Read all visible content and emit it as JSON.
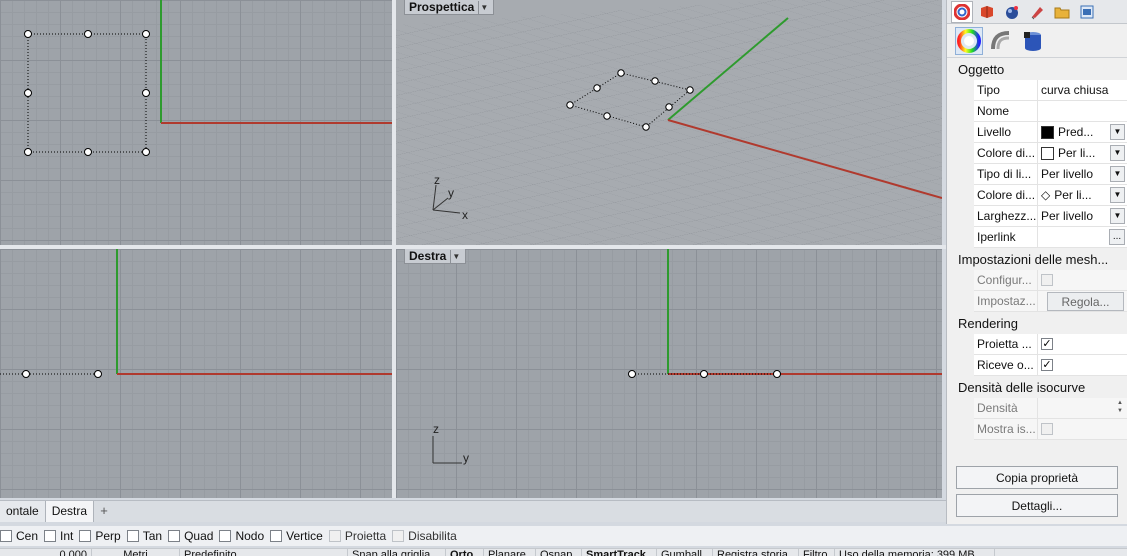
{
  "viewports": {
    "top": {
      "label": ""
    },
    "perspective": {
      "label": "Prospettica"
    },
    "front": {
      "label": ""
    },
    "right": {
      "label": "Destra"
    }
  },
  "axis_labels": {
    "x": "x",
    "y": "y",
    "z": "z"
  },
  "viewport_tabs": [
    {
      "label": "ontale",
      "active": false
    },
    {
      "label": "Destra",
      "active": true
    }
  ],
  "add_tab": "+",
  "osnaps": [
    {
      "label": "Cen",
      "checked": false,
      "enabled": true
    },
    {
      "label": "Int",
      "checked": false,
      "enabled": true
    },
    {
      "label": "Perp",
      "checked": false,
      "enabled": true
    },
    {
      "label": "Tan",
      "checked": false,
      "enabled": true
    },
    {
      "label": "Quad",
      "checked": false,
      "enabled": true
    },
    {
      "label": "Nodo",
      "checked": false,
      "enabled": true
    },
    {
      "label": "Vertice",
      "checked": false,
      "enabled": true
    },
    {
      "label": "Proietta",
      "checked": false,
      "enabled": false
    },
    {
      "label": "Disabilita",
      "checked": false,
      "enabled": false
    }
  ],
  "status": [
    "0.000",
    "Metri",
    "Predefinito",
    "Snap alla griglia",
    "Orto",
    "Planare",
    "Osnap",
    "SmartTrack",
    "Gumball",
    "Registra storia",
    "Filtro",
    "Uso della memoria: 399 MB"
  ],
  "panel": {
    "section_object": "Oggetto",
    "rows": {
      "tipo": {
        "label": "Tipo",
        "value": "curva chiusa"
      },
      "nome": {
        "label": "Nome",
        "value": ""
      },
      "livello": {
        "label": "Livello",
        "value": "Pred...",
        "swatch": "#000000"
      },
      "colore_disp": {
        "label": "Colore di...",
        "value": "Per li...",
        "swatch": "#ffffff"
      },
      "tipo_linea": {
        "label": "Tipo di li...",
        "value": "Per livello"
      },
      "colore_stampa": {
        "label": "Colore di...",
        "value": "Per li..."
      },
      "larghezza": {
        "label": "Larghezz...",
        "value": "Per livello"
      },
      "iperlink": {
        "label": "Iperlink",
        "value": "",
        "button": "..."
      }
    },
    "section_mesh": "Impostazioni delle mesh...",
    "mesh_rows": {
      "configura": {
        "label": "Configur..."
      },
      "impostazioni": {
        "label": "Impostaz...",
        "button": "Regola..."
      }
    },
    "section_render": "Rendering",
    "render_rows": {
      "proietta": {
        "label": "Proietta ...",
        "checked": true
      },
      "riceve": {
        "label": "Riceve o...",
        "checked": true
      }
    },
    "section_iso": "Densità delle isocurve",
    "iso_rows": {
      "densita": {
        "label": "Densità"
      },
      "mostra": {
        "label": "Mostra is..."
      }
    },
    "copy_button": "Copia proprietà",
    "details_button": "Dettagli..."
  },
  "colors": {
    "x_axis": "#b03a2e",
    "y_axis": "#2e9b2e",
    "viewport_bg": "#9ea3a9"
  }
}
